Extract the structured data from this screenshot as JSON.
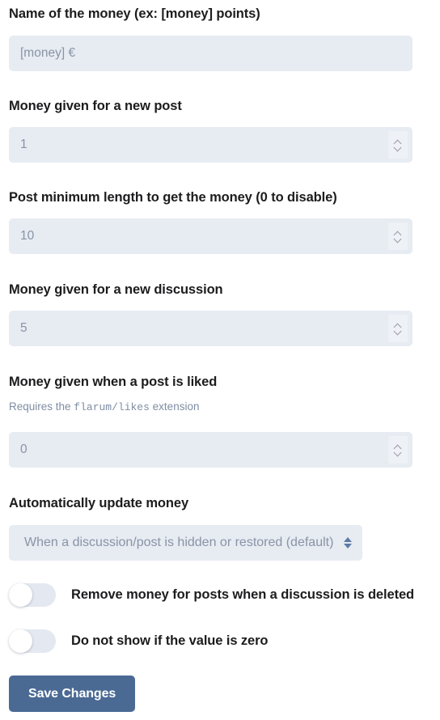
{
  "form": {
    "fields": [
      {
        "label": "Name of the money (ex: [money] points)",
        "type": "text",
        "placeholder": "[money] €",
        "value": ""
      },
      {
        "label": "Money given for a new post",
        "type": "number",
        "value": "1"
      },
      {
        "label": "Post minimum length to get the money (0 to disable)",
        "type": "number",
        "value": "10"
      },
      {
        "label": "Money given for a new discussion",
        "type": "number",
        "value": "5"
      },
      {
        "label": "Money given when a post is liked",
        "help_prefix": "Requires the ",
        "help_code": "flarum/likes",
        "help_suffix": " extension",
        "type": "number",
        "value": "0"
      },
      {
        "label": "Automatically update money",
        "type": "select",
        "value": "When a discussion/post is hidden or restored (default)"
      }
    ],
    "switches": [
      {
        "label": "Remove money for posts when a discussion is deleted",
        "checked": false
      },
      {
        "label": "Do not show if the value is zero",
        "checked": false
      }
    ],
    "save_label": "Save Changes"
  },
  "icons": {
    "spinner_up": "chevron-up-icon",
    "spinner_down": "chevron-down-icon",
    "select_arrow": "select-updown-arrow-icon"
  },
  "colors": {
    "input_background": "#e7ebf2",
    "placeholder_text": "#8a94a6",
    "label_text": "#1c1c1e",
    "help_text": "#7f8da3",
    "primary_button": "#4a6a94",
    "switch_track": "#e4e8f0",
    "select_arrow": "#5b7ba6"
  }
}
